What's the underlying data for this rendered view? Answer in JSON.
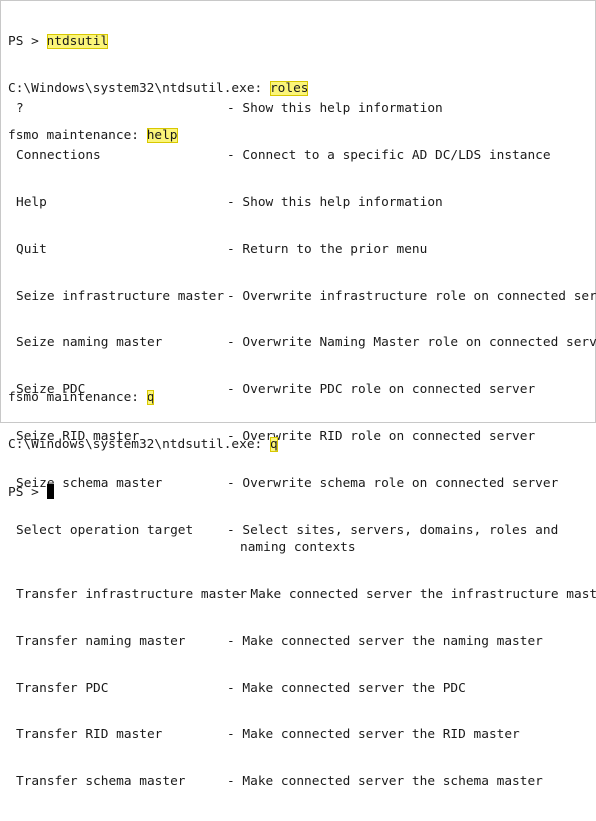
{
  "session": {
    "line1": {
      "prompt": "PS > ",
      "command": "ntdsutil"
    },
    "line2": {
      "prompt": "C:\\Windows\\system32\\ntdsutil.exe: ",
      "command": "roles"
    },
    "line3": {
      "prompt": "fsmo maintenance: ",
      "command": "help"
    }
  },
  "help_entries": [
    {
      "command": "?",
      "description": "- Show this help information"
    },
    {
      "command": "Connections",
      "description": "- Connect to a specific AD DC/LDS instance"
    },
    {
      "command": "Help",
      "description": "- Show this help information"
    },
    {
      "command": "Quit",
      "description": "- Return to the prior menu"
    },
    {
      "command": "Seize infrastructure master",
      "description": "- Overwrite infrastructure role on connected server"
    },
    {
      "command": "Seize naming master",
      "description": "- Overwrite Naming Master role on connected server"
    },
    {
      "command": "Seize PDC",
      "description": "- Overwrite PDC role on connected server"
    },
    {
      "command": "Seize RID master",
      "description": "- Overwrite RID role on connected server"
    },
    {
      "command": "Seize schema master",
      "description": "- Overwrite schema role on connected server"
    },
    {
      "command": "Select operation target",
      "description": "- Select sites, servers, domains, roles and",
      "continuation": "naming contexts"
    },
    {
      "command": "Transfer infrastructure master",
      "description": "- Make connected server the infrastructure master"
    },
    {
      "command": "Transfer naming master",
      "description": "- Make connected server the naming master"
    },
    {
      "command": "Transfer PDC",
      "description": "- Make connected server the PDC"
    },
    {
      "command": "Transfer RID master",
      "description": "- Make connected server the RID master"
    },
    {
      "command": "Transfer schema master",
      "description": "- Make connected server the schema master"
    }
  ],
  "tail": {
    "line1": {
      "prompt": "fsmo maintenance: ",
      "command": "q"
    },
    "line2": {
      "prompt": "C:\\Windows\\system32\\ntdsutil.exe: ",
      "command": "q"
    },
    "line3": {
      "prompt": "PS > "
    }
  },
  "colors": {
    "highlight": "#fbf579",
    "text": "#1a1a1a",
    "background": "#ffffff"
  }
}
